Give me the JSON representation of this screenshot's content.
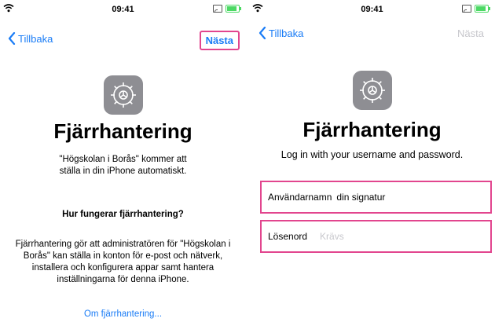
{
  "status_bar": {
    "time": "09:41"
  },
  "left": {
    "back_label": "Tillbaka",
    "next_label": "Nästa",
    "title": "Fjärrhantering",
    "subtitle": "\"Högskolan i Borås\" kommer att ställa in din iPhone automatiskt.",
    "question": "Hur fungerar fjärrhantering?",
    "body": "Fjärrhantering gör att administratören för \"Högskolan i Borås\" kan ställa in konton för e-post och nätverk, installera och konfigurera appar samt hantera inställningarna för denna iPhone.",
    "link": "Om fjärrhantering..."
  },
  "right": {
    "back_label": "Tillbaka",
    "next_label": "Nästa",
    "title": "Fjärrhantering",
    "subtitle": "Log in with your username and password.",
    "username": {
      "label": "Användarnamn",
      "value": "din signatur"
    },
    "password": {
      "label": "Lösenord",
      "placeholder": "Krävs"
    }
  },
  "colors": {
    "accent": "#1a7cf6",
    "highlight": "#e2458e",
    "icon_bg": "#8e8e93",
    "battery": "#4cd964",
    "placeholder": "#c7c7cc"
  },
  "icons": [
    "wifi-icon",
    "screen-mirror-icon",
    "battery-icon",
    "chevron-left-icon",
    "settings-gear-icon"
  ]
}
